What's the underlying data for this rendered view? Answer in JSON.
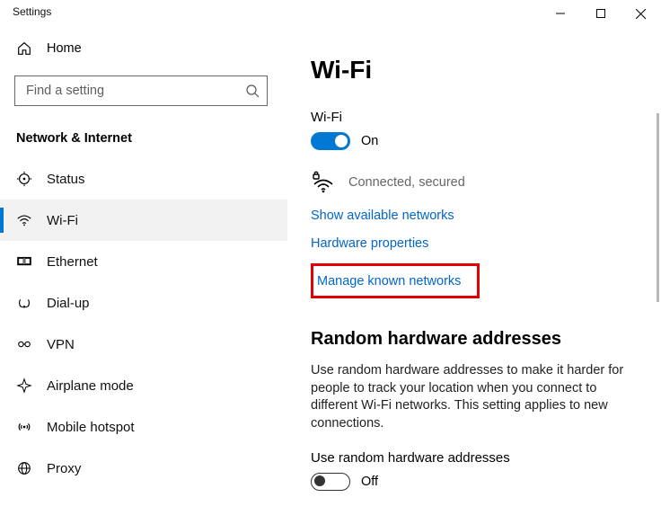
{
  "window": {
    "title": "Settings"
  },
  "sidebar": {
    "home": "Home",
    "search_placeholder": "Find a setting",
    "category": "Network & Internet",
    "items": [
      {
        "label": "Status"
      },
      {
        "label": "Wi-Fi"
      },
      {
        "label": "Ethernet"
      },
      {
        "label": "Dial-up"
      },
      {
        "label": "VPN"
      },
      {
        "label": "Airplane mode"
      },
      {
        "label": "Mobile hotspot"
      },
      {
        "label": "Proxy"
      }
    ]
  },
  "main": {
    "title": "Wi-Fi",
    "wifi_label": "Wi-Fi",
    "wifi_toggle_state": "On",
    "connection_status": "Connected, secured",
    "links": {
      "show_available": "Show available networks",
      "hardware_props": "Hardware properties",
      "manage_known": "Manage known networks"
    },
    "random_section": {
      "title": "Random hardware addresses",
      "body": "Use random hardware addresses to make it harder for people to track your location when you connect to different Wi-Fi networks. This setting applies to new connections.",
      "toggle_label": "Use random hardware addresses",
      "toggle_state": "Off"
    }
  }
}
